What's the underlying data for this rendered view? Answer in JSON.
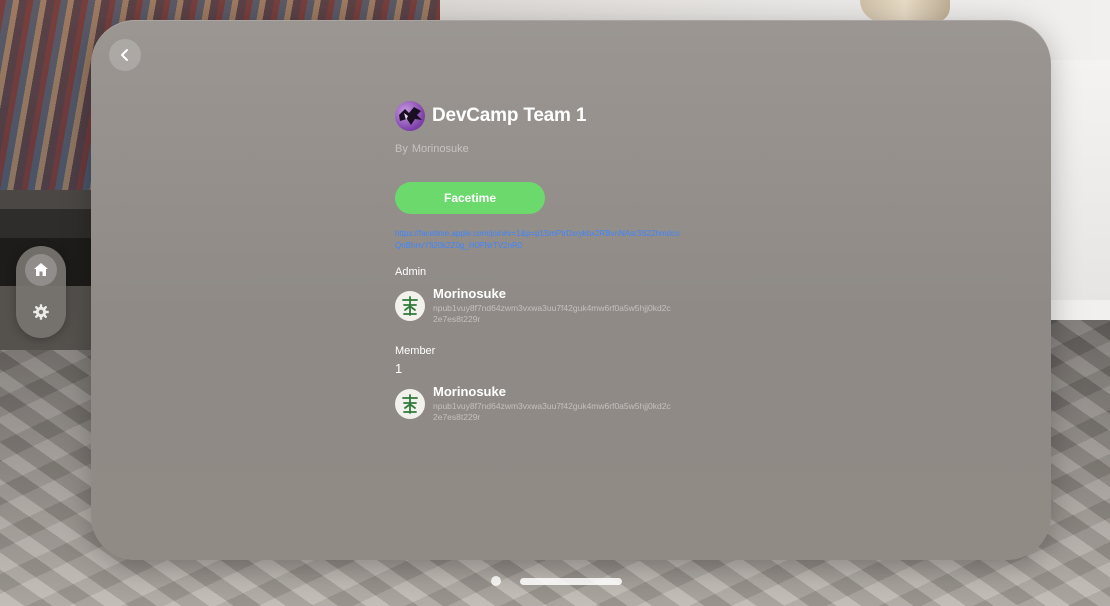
{
  "team": {
    "title": "DevCamp Team 1",
    "by_label": "By",
    "author": "Morinosuke"
  },
  "facetime": {
    "button_label": "Facetime",
    "link": "https://facetime.apple.com/join#v=1&p=p1SmPtrDxrykbx2RBvnNAsr3S22hmdcoQnBhnvYfi20k2Z0g_H0PNrTV2nR0"
  },
  "admin": {
    "label": "Admin",
    "people": [
      {
        "name": "Morinosuke",
        "npub": "npub1vuy8f7nd64zwm3vxwa3uu7f42guk4mw6rf0a5w5hjj0kd2c2e7es8t229r"
      }
    ]
  },
  "member": {
    "label": "Member",
    "count": "1",
    "people": [
      {
        "name": "Morinosuke",
        "npub": "npub1vuy8f7nd64zwm3vxwa3uu7f42guk4mw6rf0a5w5hjj0kd2c2e7es8t229r"
      }
    ]
  },
  "ornament": {
    "items": [
      "house-icon",
      "gear-icon"
    ]
  },
  "colors": {
    "facetime_green": "#6bd96c",
    "link_blue": "#3f86ff"
  }
}
